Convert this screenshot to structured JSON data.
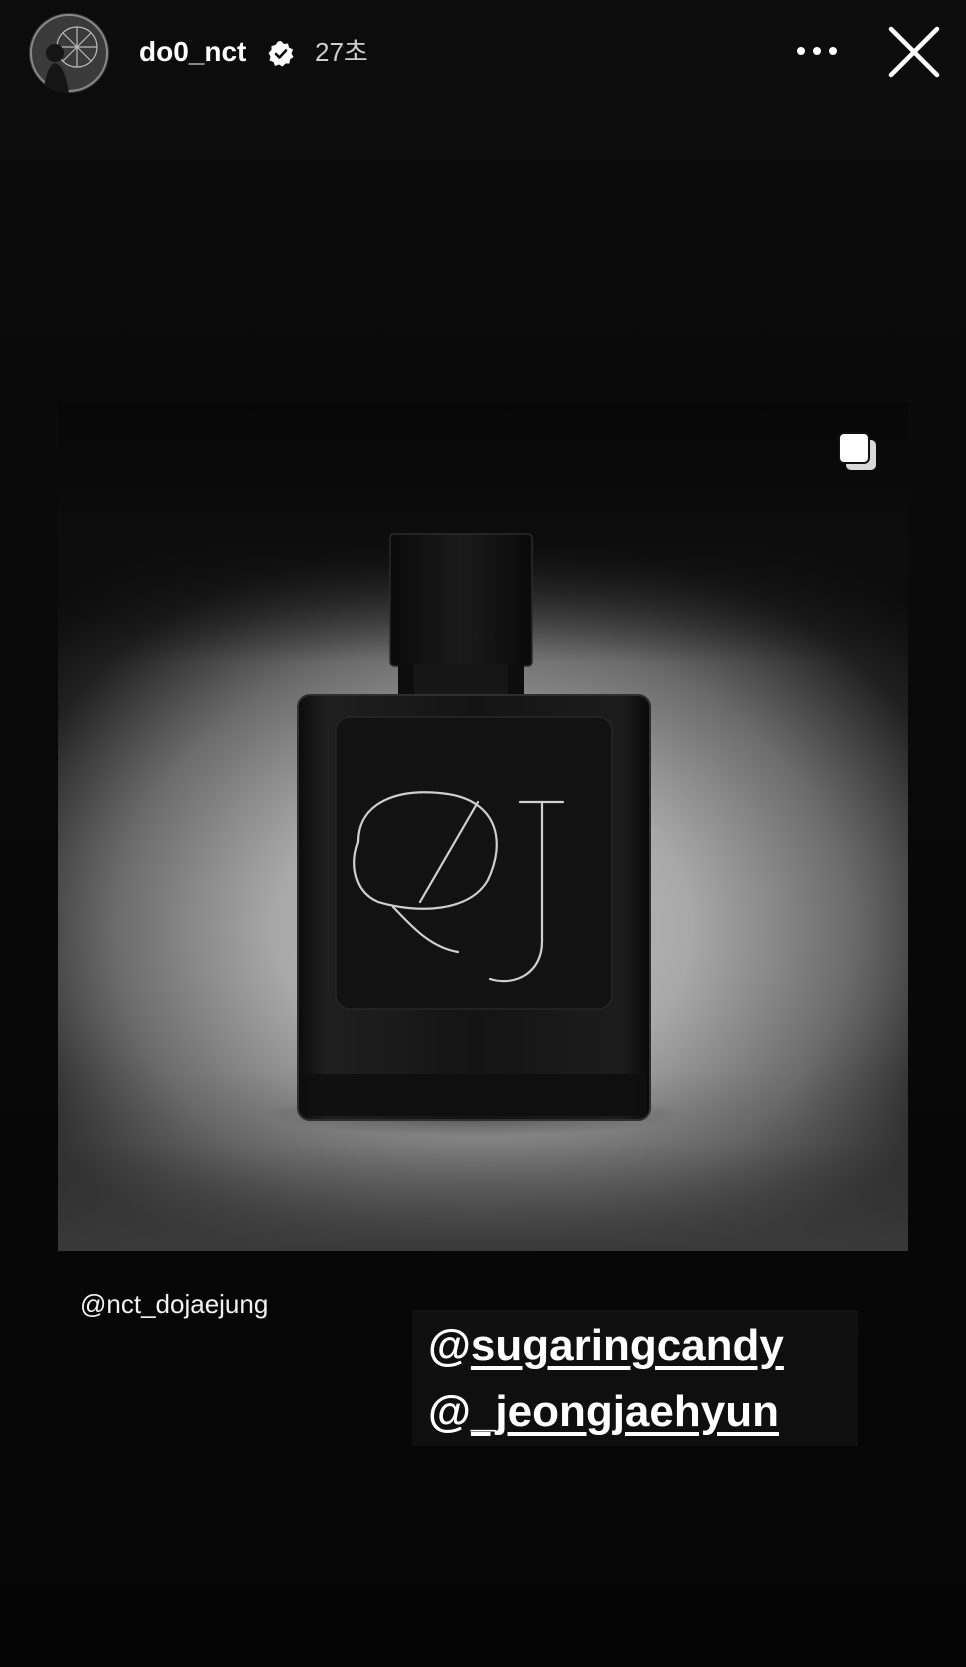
{
  "story": {
    "username": "do0_nct",
    "verified": true,
    "time_ago": "27초"
  },
  "icons": {
    "avatar": "profile-avatar",
    "verified": "verified-badge-icon",
    "more": "more-options-icon",
    "close": "close-icon",
    "carousel": "multiple-images-icon"
  },
  "post": {
    "source_handle": "@nct_dojaejung",
    "logo_text": "DJ"
  },
  "mentions": [
    {
      "at": "@",
      "handle": "sugaringcandy"
    },
    {
      "at": "@",
      "handle": "_jeongjaehyun"
    }
  ],
  "colors": {
    "background": "#0a0a0a",
    "text": "#ffffff",
    "muted_text": "#cfcfcf"
  }
}
